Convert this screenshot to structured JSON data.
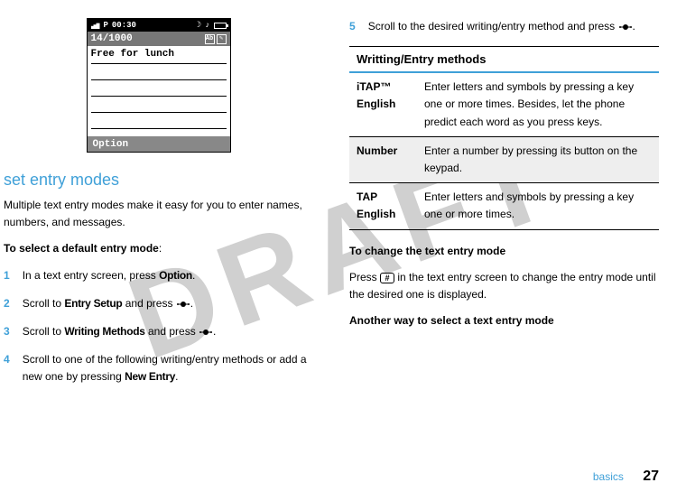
{
  "watermark": "DRAFT",
  "phone": {
    "time": "00:30",
    "status_p": "P",
    "counter": "14/1000",
    "text": "Free for lunch",
    "option": "Option"
  },
  "left": {
    "section_title": "set entry modes",
    "intro": "Multiple text entry modes make it easy for you to enter names, numbers, and messages.",
    "select_heading_prefix": "To select a default entry mode",
    "select_heading_suffix": ":",
    "steps": {
      "s1_a": "In a text entry screen, press ",
      "s1_b": "Option",
      "s1_c": ".",
      "s2_a": "Scroll to ",
      "s2_b": "Entry Setup",
      "s2_c": " and press ",
      "s2_d": ".",
      "s3_a": "Scroll to ",
      "s3_b": "Writing Methods",
      "s3_c": " and press ",
      "s3_d": ".",
      "s4_a": "Scroll to one of the following writing/entry methods or add a new one by pressing ",
      "s4_b": "New Entry",
      "s4_c": "."
    }
  },
  "right": {
    "step5_a": "Scroll to the desired writing/entry method and press ",
    "step5_b": ".",
    "table": {
      "header": "Writting/Entry methods",
      "rows": [
        {
          "label": "iTAP™ English",
          "desc": "Enter letters and symbols by pressing a key one or more times. Besides, let the phone predict each word as you press keys."
        },
        {
          "label": "Number",
          "desc": "Enter a number by pressing its button on the keypad."
        },
        {
          "label": "TAP English",
          "desc": "Enter letters and symbols by pressing a key one or more times."
        }
      ]
    },
    "change_heading": "To change the text entry mode",
    "change_a": "Press ",
    "change_b": " in the text entry screen to change the entry mode until the desired one is displayed.",
    "another_heading": "Another way to select a text entry mode",
    "hash": "#"
  },
  "footer": {
    "label": "basics",
    "page": "27"
  },
  "nums": {
    "n1": "1",
    "n2": "2",
    "n3": "3",
    "n4": "4",
    "n5": "5"
  }
}
